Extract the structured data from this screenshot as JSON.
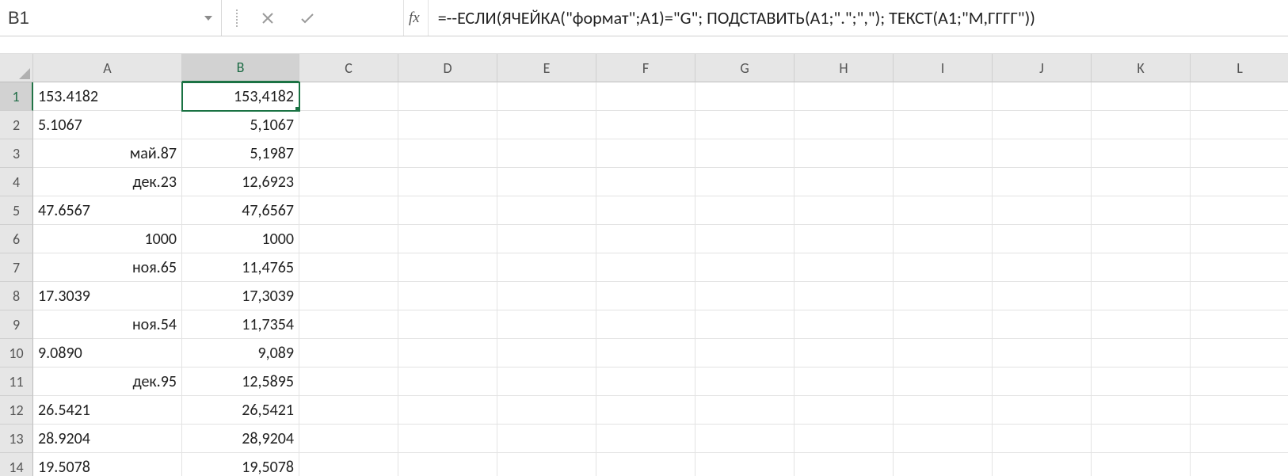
{
  "name_box": "B1",
  "formula_icons": {
    "fx": "fx"
  },
  "formula": "=--ЕСЛИ(ЯЧЕЙКА(\"формат\";A1)=\"G\"; ПОДСТАВИТЬ(A1;\".\";\",\"); ТЕКСТ(A1;\"М,ГГГГ\"))",
  "columns": [
    "A",
    "B",
    "C",
    "D",
    "E",
    "F",
    "G",
    "H",
    "I",
    "J",
    "K",
    "L"
  ],
  "active": {
    "col": "B",
    "row": 1
  },
  "rows": [
    {
      "n": 1,
      "A": {
        "v": "153.4182",
        "align": "left"
      },
      "B": {
        "v": "153,4182",
        "align": "right"
      }
    },
    {
      "n": 2,
      "A": {
        "v": "5.1067",
        "align": "left"
      },
      "B": {
        "v": "5,1067",
        "align": "right"
      }
    },
    {
      "n": 3,
      "A": {
        "v": "май.87",
        "align": "right"
      },
      "B": {
        "v": "5,1987",
        "align": "right"
      }
    },
    {
      "n": 4,
      "A": {
        "v": "дек.23",
        "align": "right"
      },
      "B": {
        "v": "12,6923",
        "align": "right"
      }
    },
    {
      "n": 5,
      "A": {
        "v": "47.6567",
        "align": "left"
      },
      "B": {
        "v": "47,6567",
        "align": "right"
      }
    },
    {
      "n": 6,
      "A": {
        "v": "1000",
        "align": "right"
      },
      "B": {
        "v": "1000",
        "align": "right"
      }
    },
    {
      "n": 7,
      "A": {
        "v": "ноя.65",
        "align": "right"
      },
      "B": {
        "v": "11,4765",
        "align": "right"
      }
    },
    {
      "n": 8,
      "A": {
        "v": "17.3039",
        "align": "left"
      },
      "B": {
        "v": "17,3039",
        "align": "right"
      }
    },
    {
      "n": 9,
      "A": {
        "v": "ноя.54",
        "align": "right"
      },
      "B": {
        "v": "11,7354",
        "align": "right"
      }
    },
    {
      "n": 10,
      "A": {
        "v": "9.0890",
        "align": "left"
      },
      "B": {
        "v": "9,089",
        "align": "right"
      }
    },
    {
      "n": 11,
      "A": {
        "v": "дек.95",
        "align": "right"
      },
      "B": {
        "v": "12,5895",
        "align": "right"
      }
    },
    {
      "n": 12,
      "A": {
        "v": "26.5421",
        "align": "left"
      },
      "B": {
        "v": "26,5421",
        "align": "right"
      }
    },
    {
      "n": 13,
      "A": {
        "v": "28.9204",
        "align": "left"
      },
      "B": {
        "v": "28,9204",
        "align": "right"
      }
    },
    {
      "n": 14,
      "A": {
        "v": "19.5078",
        "align": "left"
      },
      "B": {
        "v": "19,5078",
        "align": "right"
      }
    }
  ]
}
